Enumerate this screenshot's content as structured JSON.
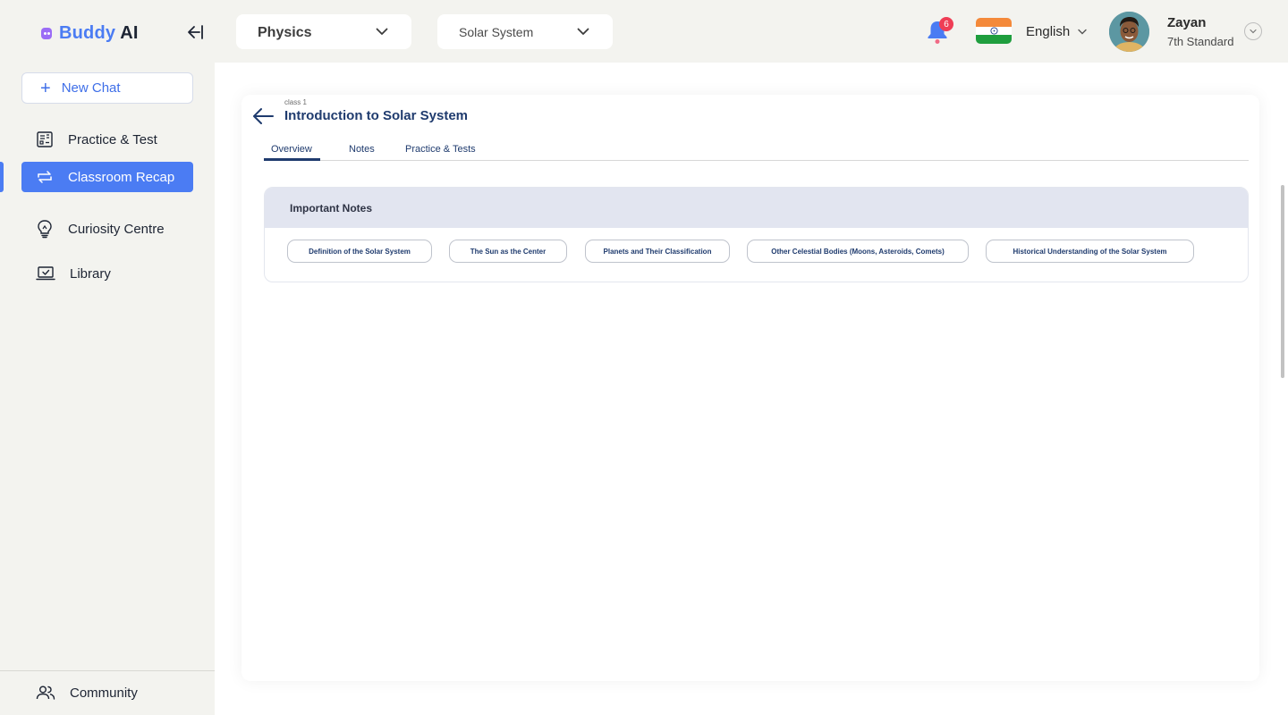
{
  "app": {
    "logo_buddy": "Buddy",
    "logo_ai": "AI"
  },
  "sidebar": {
    "new_chat": "New Chat",
    "items": [
      {
        "label": "Practice & Test",
        "icon": "practice-test-icon"
      },
      {
        "label": "Classroom Recap",
        "icon": "recap-icon",
        "active": true
      },
      {
        "label": "Curiosity Centre",
        "icon": "lightbulb-icon"
      },
      {
        "label": "Library",
        "icon": "library-icon"
      }
    ],
    "community": "Community"
  },
  "topbar": {
    "subject": "Physics",
    "topic": "Solar System",
    "notification_count": "6",
    "language": "English",
    "user_name": "Zayan",
    "user_grade": "7th Standard"
  },
  "content": {
    "crumb": "class 1",
    "title": "Introduction to Solar System",
    "tabs": [
      "Overview",
      "Notes",
      "Practice & Tests"
    ],
    "active_tab": "Overview",
    "notes_header": "Important Notes",
    "chips": [
      "Definition of the Solar System",
      "The Sun as the Center",
      "Planets and Their Classification",
      "Other Celestial Bodies (Moons, Asteroids, Comets)",
      "Historical Understanding of the Solar System"
    ]
  },
  "colors": {
    "accent": "#4b7cf3",
    "title": "#1f3b6e",
    "badge": "#ef3d55",
    "notes_header_bg": "#e2e5f0"
  }
}
